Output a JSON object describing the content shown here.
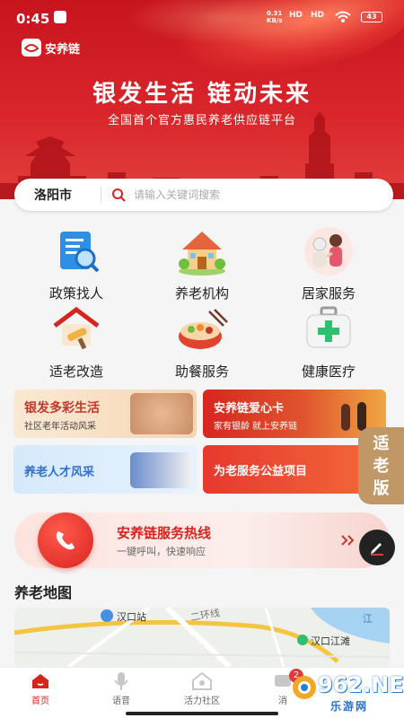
{
  "status_bar": {
    "time": "0:45",
    "network_speed_top": "0.31",
    "network_speed_bottom": "KB/s",
    "signal_1": "HD",
    "signal_2": "HD",
    "battery": "43"
  },
  "app": {
    "name": "安养链"
  },
  "hero": {
    "slogan": "银发生活  链动未来",
    "subtitle": "全国首个官方惠民养老供应链平台"
  },
  "search": {
    "city": "洛阳市",
    "placeholder": "请输入关键词搜索"
  },
  "grid": [
    {
      "label": "政策找人",
      "icon": "policy-document-icon"
    },
    {
      "label": "养老机构",
      "icon": "nursing-home-icon"
    },
    {
      "label": "居家服务",
      "icon": "home-care-icon"
    },
    {
      "label": "适老改造",
      "icon": "home-renovation-icon"
    },
    {
      "label": "助餐服务",
      "icon": "meal-service-icon"
    },
    {
      "label": "健康医疗",
      "icon": "medical-kit-icon"
    }
  ],
  "banners": [
    {
      "title": "银发多彩生活",
      "subtitle": "社区老年活动风采"
    },
    {
      "title": "安养链爱心卡",
      "subtitle": "家有银龄 就上安养链"
    },
    {
      "title": "养老人才风采",
      "subtitle": ""
    },
    {
      "title": "为老服务公益项目",
      "subtitle": ""
    }
  ],
  "elder_mode": {
    "chars": [
      "适",
      "老",
      "版"
    ]
  },
  "hotline": {
    "title": "安养链服务热线",
    "subtitle": "一键呼叫，快速响应",
    "icon": "phone-icon"
  },
  "map_section": {
    "title": "养老地图",
    "labels": [
      "汉口站",
      "二环线",
      "汉口江滩",
      "江"
    ]
  },
  "tabs": [
    {
      "label": "首页",
      "icon": "home-icon",
      "active": true
    },
    {
      "label": "语音",
      "icon": "microphone-icon",
      "active": false
    },
    {
      "label": "活力社区",
      "icon": "community-icon",
      "active": false
    },
    {
      "label": "消",
      "icon": "message-icon",
      "active": false
    }
  ],
  "badge_count": "2",
  "watermark": {
    "main": "962.NET",
    "sub": "乐游网"
  },
  "colors": {
    "brand_red": "#d8241f",
    "hero_red": "#c8141e",
    "elder_gold": "#c09868"
  }
}
